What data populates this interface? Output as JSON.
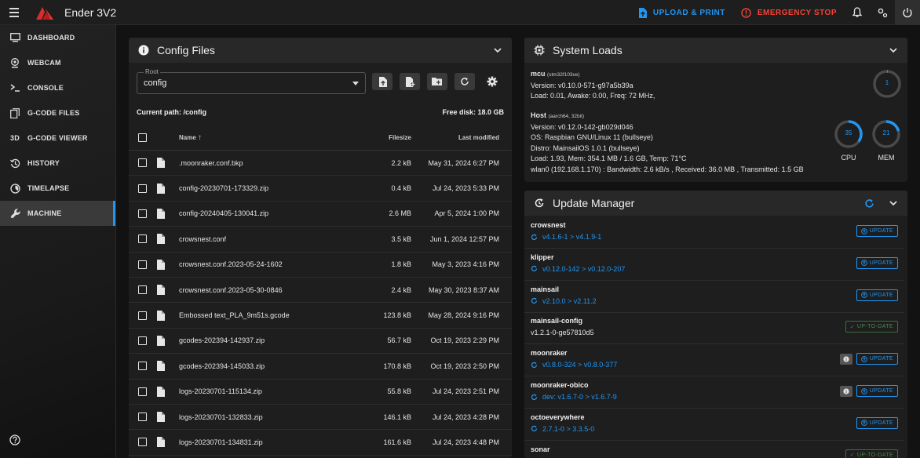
{
  "header": {
    "printer_name": "Ender 3V2",
    "upload_label": "UPLOAD & PRINT",
    "estop_label": "EMERGENCY STOP"
  },
  "sidebar": {
    "items": [
      {
        "label": "DASHBOARD",
        "icon": "dashboard-icon"
      },
      {
        "label": "WEBCAM",
        "icon": "webcam-icon"
      },
      {
        "label": "CONSOLE",
        "icon": "console-icon"
      },
      {
        "label": "G-CODE FILES",
        "icon": "files-icon"
      },
      {
        "label": "G-CODE VIEWER",
        "icon": "3d-icon"
      },
      {
        "label": "HISTORY",
        "icon": "history-icon"
      },
      {
        "label": "TIMELAPSE",
        "icon": "timelapse-icon"
      },
      {
        "label": "MACHINE",
        "icon": "wrench-icon"
      }
    ],
    "active_index": 7,
    "viewer_glyph": "3D"
  },
  "config_files": {
    "title": "Config Files",
    "root_label": "Root",
    "root_value": "config",
    "current_path": "Current path: /config",
    "free_disk": "Free disk: 18.0 GB",
    "columns": {
      "name": "Name",
      "size": "Filesize",
      "modified": "Last modified"
    },
    "files": [
      {
        "name": ".moonraker.conf.bkp",
        "size": "2.2 kB",
        "modified": "May 31, 2024 6:27 PM"
      },
      {
        "name": "config-20230701-173329.zip",
        "size": "0.4 kB",
        "modified": "Jul 24, 2023 5:33 PM"
      },
      {
        "name": "config-20240405-130041.zip",
        "size": "2.6 MB",
        "modified": "Apr 5, 2024 1:00 PM"
      },
      {
        "name": "crowsnest.conf",
        "size": "3.5 kB",
        "modified": "Jun 1, 2024 12:57 PM"
      },
      {
        "name": "crowsnest.conf.2023-05-24-1602",
        "size": "1.8 kB",
        "modified": "May 3, 2023 4:16 PM"
      },
      {
        "name": "crowsnest.conf.2023-05-30-0846",
        "size": "2.4 kB",
        "modified": "May 30, 2023 8:37 AM"
      },
      {
        "name": "Embossed text_PLA_9m51s.gcode",
        "size": "123.8 kB",
        "modified": "May 28, 2024 9:16 PM"
      },
      {
        "name": "gcodes-202394-142937.zip",
        "size": "56.7 kB",
        "modified": "Oct 19, 2023 2:29 PM"
      },
      {
        "name": "gcodes-202394-145033.zip",
        "size": "170.8 kB",
        "modified": "Oct 19, 2023 2:50 PM"
      },
      {
        "name": "logs-20230701-115134.zip",
        "size": "55.8 kB",
        "modified": "Jul 24, 2023 2:51 PM"
      },
      {
        "name": "logs-20230701-132833.zip",
        "size": "146.1 kB",
        "modified": "Jul 24, 2023 4:28 PM"
      },
      {
        "name": "logs-20230701-134831.zip",
        "size": "161.6 kB",
        "modified": "Jul 24, 2023 4:48 PM"
      }
    ]
  },
  "system_loads": {
    "title": "System Loads",
    "mcu": {
      "name": "mcu",
      "chip": "(stm32f103xe)",
      "version": "Version: v0.10.0-571-g97a5b39a",
      "load": "Load: 0.01, Awake: 0.00, Freq: 72 MHz,",
      "gauge_value": "1"
    },
    "host": {
      "name": "Host",
      "arch": "(aarch64, 32bit)",
      "version": "Version: v0.12.0-142-gb029d046",
      "os": "OS: Raspbian GNU/Linux 11 (bullseye)",
      "distro": "Distro: MainsailOS 1.0.1 (bullseye)",
      "load": "Load: 1.93, Mem: 354.1 MB / 1.6 GB, Temp: 71°C",
      "network": "wlan0 (192.168.1.170) : Bandwidth: 2.6 kB/s , Received: 36.0 MB , Transmitted: 1.5 GB",
      "cpu_value": "35",
      "cpu_label": "CPU",
      "mem_value": "21",
      "mem_label": "MEM"
    }
  },
  "update_manager": {
    "title": "Update Manager",
    "update_label": "UPDATE",
    "uptodate_label": "UP-TO-DATE",
    "items": [
      {
        "name": "crowsnest",
        "version": "v4.1.6-1 > v4.1.9-1"
      },
      {
        "name": "klipper",
        "version": "v0.12.0-142 > v0.12.0-207"
      },
      {
        "name": "mainsail",
        "version": "v2.10.0 > v2.11.2"
      },
      {
        "name": "mainsail-config",
        "version": "v1.2.1-0-ge57810d5"
      },
      {
        "name": "moonraker",
        "version": "v0.8.0-324 > v0.8.0-377"
      },
      {
        "name": "moonraker-obico",
        "version": "dev: v1.6.7-0 > v1.6.7-9"
      },
      {
        "name": "octoeverywhere",
        "version": "2.7.1-0 > 3.3.5-0"
      },
      {
        "name": "sonar",
        "version": ""
      }
    ]
  },
  "colors": {
    "accent": "#2196f3",
    "danger": "#f44336",
    "success": "#4a8a4d"
  }
}
